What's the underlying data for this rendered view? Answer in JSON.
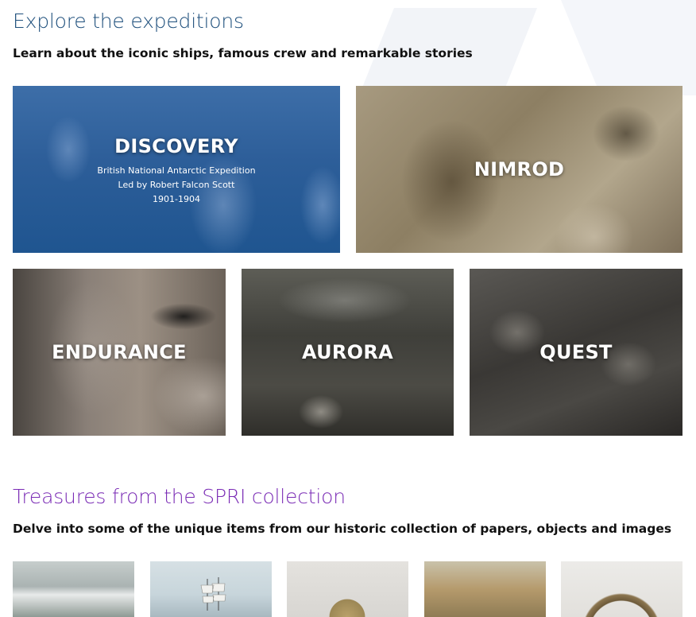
{
  "explore": {
    "title": "Explore the expeditions",
    "subtitle": "Learn about the iconic ships, famous crew and remarkable stories"
  },
  "expeditions": [
    {
      "name": "DISCOVERY",
      "line1": "British National Antarctic Expedition",
      "line2": "Led by Robert Falcon Scott",
      "years": "1901-1904"
    },
    {
      "name": "NIMROD"
    },
    {
      "name": "ENDURANCE"
    },
    {
      "name": "AURORA"
    },
    {
      "name": "QUEST"
    }
  ],
  "treasures": {
    "title": "Treasures from the SPRI collection",
    "subtitle": "Delve into some of the unique items from our historic collection of papers, objects and images"
  },
  "colors": {
    "explore_title": "#1e4f7c",
    "treasures_title": "#7a2bb5",
    "discovery_tint": "#2d5e99"
  }
}
